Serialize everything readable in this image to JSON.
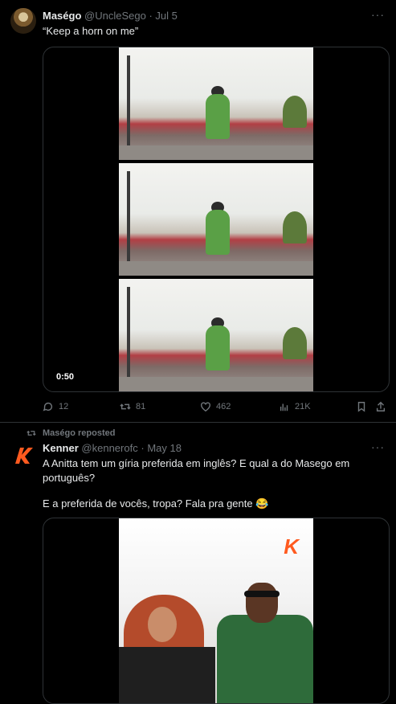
{
  "tweet1": {
    "name": "Maségo",
    "handle": "@UncleSego",
    "date": "Jul 5",
    "dot": "·",
    "text": "“Keep a horn on me”",
    "duration": "0:50",
    "replies": "12",
    "reposts": "81",
    "likes": "462",
    "views": "21K"
  },
  "repost_label": "Maségo reposted",
  "tweet2": {
    "name": "Kenner",
    "handle": "@kennerofc",
    "date": "May 18",
    "dot": "·",
    "text_line1": "A Anitta tem um gíria preferida em inglês? E qual a do Masego em",
    "text_line2": "português?",
    "text_line3": "E a preferida de vocês, tropa? Fala pra gente 😂",
    "logo_letter": "K"
  },
  "colors": {
    "accent": "#ff5a1f",
    "muted": "#71767b",
    "border": "#2f3336"
  }
}
